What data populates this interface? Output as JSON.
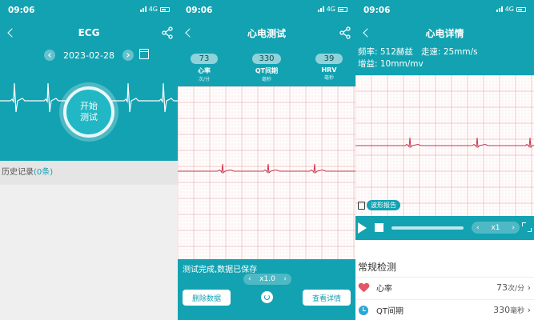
{
  "status_bar": {
    "time": "09:06",
    "network": "4G"
  },
  "colors": {
    "accent": "#13a2b1",
    "ecg_trace": "#c8334a",
    "grid_major": "#f2b3b3",
    "grid_minor": "#fbe2e2"
  },
  "screen1": {
    "title": "ECG",
    "date": "2023-02-28",
    "start_button": [
      "开始",
      "测试"
    ],
    "history_label": "历史记录",
    "history_count": "(0条)"
  },
  "screen2": {
    "title": "心电测试",
    "stats": [
      {
        "value": "73",
        "label": "心率",
        "unit": "次/分"
      },
      {
        "value": "330",
        "label": "QT间期",
        "unit": "毫秒"
      },
      {
        "value": "39",
        "label": "HRV",
        "unit": "毫秒"
      }
    ],
    "saved_message": "测试完成,数据已保存",
    "speed": "x1.0",
    "delete_button": "删除数据",
    "view_button": "查看详情"
  },
  "screen3": {
    "title": "心电详情",
    "frequency": "频率: 512赫兹",
    "paper_speed": "走速: 25mm/s",
    "gain": "增益: 10mm/mv",
    "report_label": "波形报告",
    "speed": "x1",
    "section_title": "常规检测",
    "metrics": [
      {
        "name": "心率",
        "value": "73",
        "unit": "次/分",
        "icon": "heart-icon"
      },
      {
        "name": "QT间期",
        "value": "330",
        "unit": "毫秒",
        "icon": "clock-icon"
      }
    ]
  }
}
